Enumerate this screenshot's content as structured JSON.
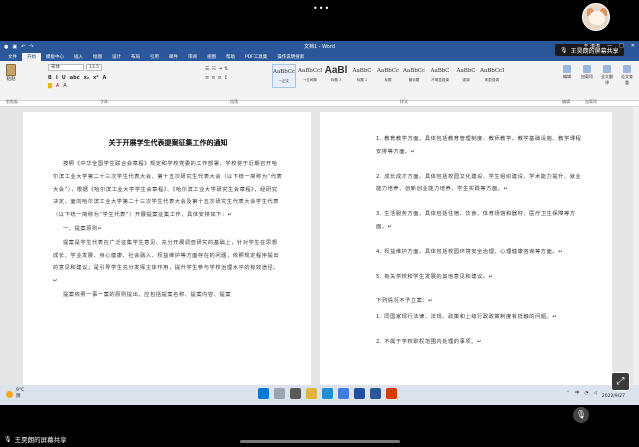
{
  "overlay": {
    "dots": "•••",
    "share_label": "王昊朗的屏幕共享",
    "bottom_label": "王昊朗的屏幕共享"
  },
  "word": {
    "title": "文档1 - Word",
    "user": "王 涛涛",
    "menu": [
      "文件",
      "开始",
      "模板中心",
      "插入",
      "绘图",
      "设计",
      "布局",
      "引用",
      "邮件",
      "审阅",
      "视图",
      "帮助",
      "PDF工具集",
      "操作说明搜索"
    ],
    "active_menu": "开始",
    "ribbon": {
      "paste_label": "粘贴",
      "font_name": "宋体",
      "font_size": "13.5",
      "format_row": [
        "B",
        "I",
        "U",
        "abc",
        "x₂",
        "x²",
        "A"
      ],
      "groups": [
        "剪贴板",
        "字体",
        "段落",
        "样式",
        "编辑",
        "加载项"
      ],
      "styles": [
        {
          "sample": "AaBbCcDc",
          "name": "→正文",
          "big": false,
          "selected": true
        },
        {
          "sample": "AaBbCcDc",
          "name": "→无间隔",
          "big": false,
          "selected": false
        },
        {
          "sample": "AaBl",
          "name": "标题 1",
          "big": true,
          "selected": false
        },
        {
          "sample": "AaBbC",
          "name": "标题 2",
          "big": false,
          "selected": false
        },
        {
          "sample": "AaBbCc",
          "name": "标题",
          "big": false,
          "selected": false
        },
        {
          "sample": "AaBbCc",
          "name": "副标题",
          "big": false,
          "selected": false
        },
        {
          "sample": "AaBbC",
          "name": "不明显强调",
          "big": false,
          "selected": false
        },
        {
          "sample": "AaBbC",
          "name": "强调",
          "big": false,
          "selected": false
        },
        {
          "sample": "AaBbCcDc",
          "name": "明显强调",
          "big": false,
          "selected": false
        }
      ],
      "right_buttons": [
        "编辑",
        "加载项",
        "全文翻译",
        "论文查重"
      ]
    },
    "left_page": {
      "title": "关于开展学生代表提案征集工作的通知",
      "paragraphs": [
        "按照《中华全国学生联合会章程》规定和学校党委的工作部署，学校将于近期召开哈尔滨工业大学第二十三次学生代表大会、第十五次研究生代表大会（以下统一简称为“代表大会”），根据《哈尔滨工业大学学生会章程》、《哈尔滨工业大学研究生会章程》，经研究决定，面向哈尔滨工业大学第二十三次学生代表大会及第十五次研究生代表大会学生代表（以下统一简称为“学生代表”）开展提案征集工作，具体安排如下：↵",
        "一、提案原则↵",
        "提案是学生代表在广泛征集学生意见、充分开展调查研究的基础上，针对学生在思想成长、学业发展、身心健康、社会融入、权益维护等方面存在的问题，依照规定程序提出的意见和建议；是引导学生充分发挥主体作用，提升学生参与学校治理水平的有效途径。↵",
        "提案依照一事一案的原则提出，应包括提案名称、提案内容、提案"
      ]
    },
    "right_page": {
      "items": [
        "1. 教育教学方面。具体包括教育管理制度、教师教学、教学基础设施、教学课程安排等方面。↵",
        "2. 成长成才方面。具体包括校园文化建设、学生组织建设、学术能力提升、就业能力培养、创新创业能力培养、学生实践等方面。↵",
        "3. 生活服务方面。具体包括住宿、饮食、体育场馆和器材、医疗卫生保障等方面。↵",
        "4. 权益维护方面。具体包括校园环境安全治理、心理健康咨询等方面。↵",
        "5. 有关学校和学生发展的其他意见和建议。↵",
        "下列情况不予立案：↵",
        "1. 同国家现行法律、法规、政策和上级行政政策制度有抵触的问题。↵",
        "2. 不属于学校职权范围内处理的事项。↵"
      ]
    },
    "status": {
      "page": "第 1 页，共 4 页",
      "words": "1283 个字",
      "lang": "中文(中国)",
      "access": "辅助功能: 一切就绪",
      "zoom": "100%"
    }
  },
  "taskbar": {
    "weather_temp": "9°C",
    "weather_desc": "阴",
    "tray_text": "中",
    "time": "19:09",
    "date": "2022/9/27"
  },
  "colors": {
    "word_blue": "#2b579a"
  }
}
